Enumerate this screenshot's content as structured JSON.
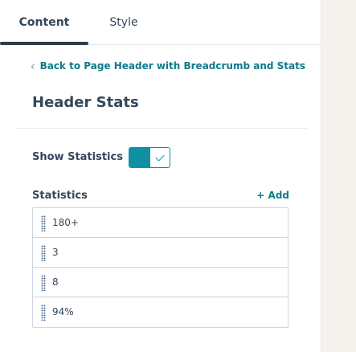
{
  "tabs": [
    {
      "label": "Content",
      "active": true
    },
    {
      "label": "Style",
      "active": false
    }
  ],
  "back_link": {
    "label": "Back to Page Header with Breadcrumb and Stats"
  },
  "section": {
    "title": "Header Stats"
  },
  "show_statistics": {
    "label": "Show Statistics",
    "enabled": true
  },
  "statistics": {
    "label": "Statistics",
    "add_label": "+ Add",
    "items": [
      {
        "value": "180+"
      },
      {
        "value": "3"
      },
      {
        "value": "8"
      },
      {
        "value": "94%"
      }
    ]
  },
  "colors": {
    "accent": "#0f91a3",
    "link": "#0f7a8b",
    "text": "#33475b",
    "border": "#cbd6e2"
  }
}
